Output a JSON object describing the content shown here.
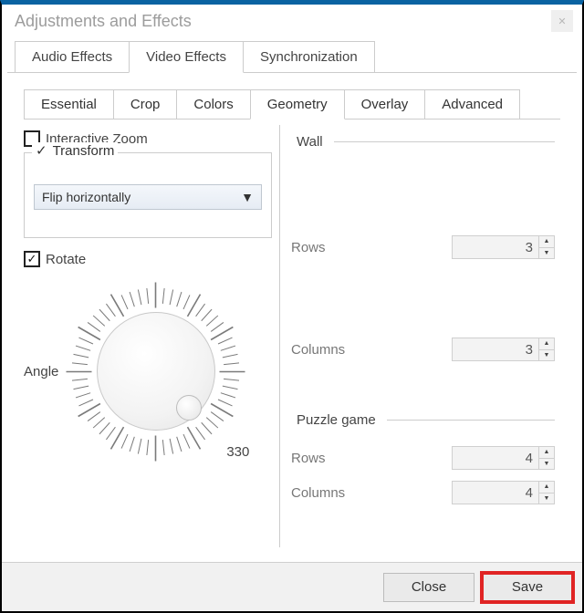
{
  "window": {
    "title": "Adjustments and Effects"
  },
  "main_tabs": {
    "audio": "Audio Effects",
    "video": "Video Effects",
    "sync": "Synchronization",
    "active": "video"
  },
  "sub_tabs": {
    "essential": "Essential",
    "crop": "Crop",
    "colors": "Colors",
    "geometry": "Geometry",
    "overlay": "Overlay",
    "advanced": "Advanced",
    "active": "geometry"
  },
  "interactive_zoom": {
    "label": "Interactive Zoom",
    "checked": false
  },
  "transform": {
    "label": "Transform",
    "checked": true,
    "selected": "Flip horizontally"
  },
  "rotate": {
    "label": "Rotate",
    "checked": true,
    "angle_label": "Angle",
    "value": 330
  },
  "wall": {
    "label": "Wall",
    "checked": false,
    "rows": {
      "label": "Rows",
      "value": 3
    },
    "columns": {
      "label": "Columns",
      "value": 3
    }
  },
  "puzzle": {
    "label": "Puzzle game",
    "checked": false,
    "rows": {
      "label": "Rows",
      "value": 4
    },
    "columns": {
      "label": "Columns",
      "value": 4
    }
  },
  "buttons": {
    "close": "Close",
    "save": "Save"
  }
}
